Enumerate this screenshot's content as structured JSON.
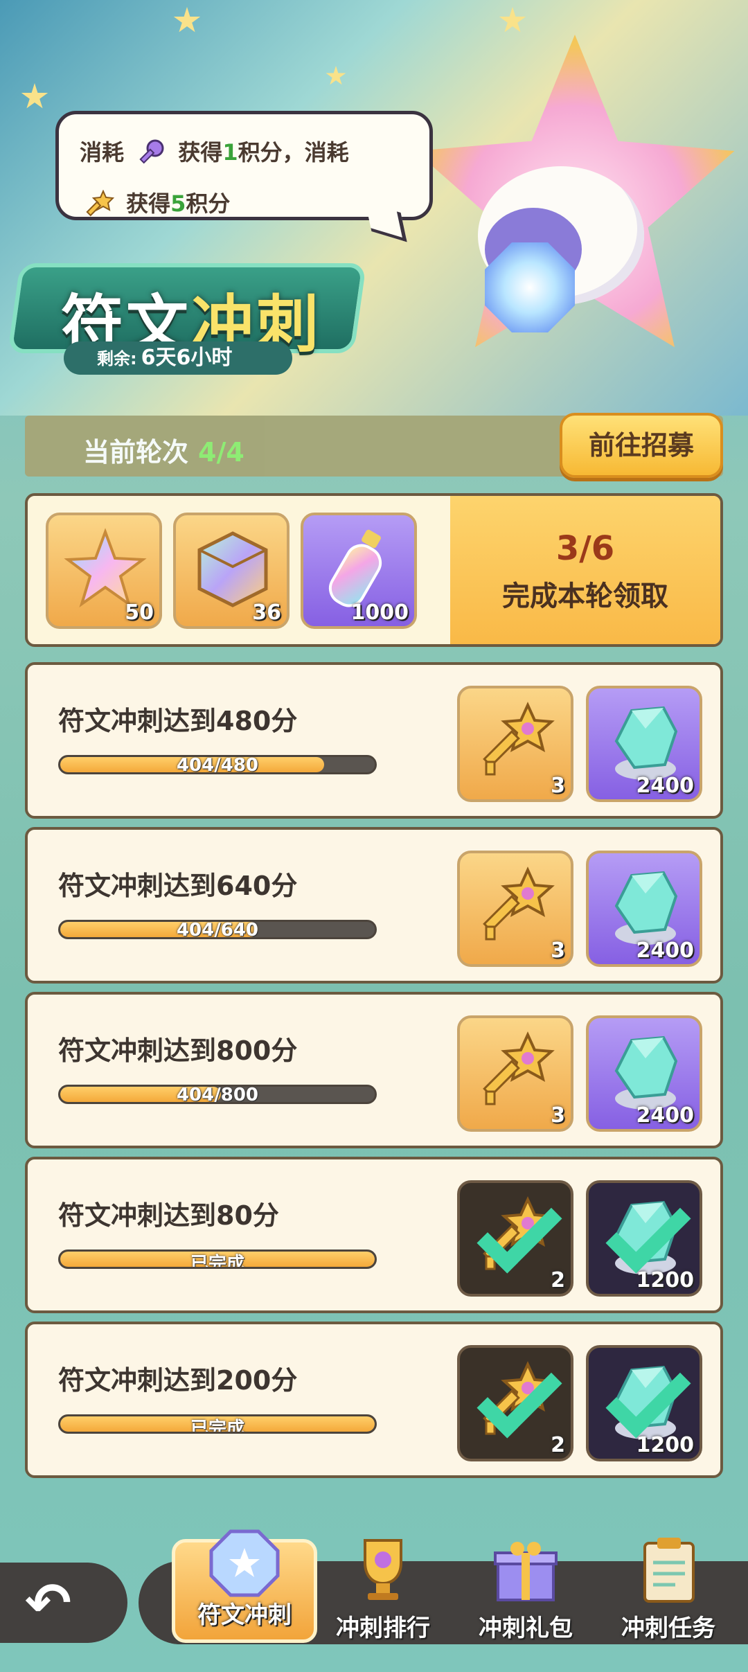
{
  "event": {
    "title_part1": "符文",
    "title_part2": "冲刺",
    "remain_label": "剩余:",
    "remain_value": "6天6小时"
  },
  "tip": {
    "line1_a": "消耗",
    "line1_b": "获得",
    "line1_num": "1",
    "line1_c": "积分，消耗",
    "line2_a": "获得",
    "line2_num": "5",
    "line2_b": "积分"
  },
  "round": {
    "label": "当前轮次",
    "value": "4/4",
    "goto_label": "前往招募"
  },
  "round_reward": {
    "items": [
      {
        "icon": "rainbow-star-icon",
        "count": "50"
      },
      {
        "icon": "rainbow-cube-icon",
        "count": "36"
      },
      {
        "icon": "rainbow-bottle-icon",
        "count": "1000"
      }
    ],
    "progress": "3/6",
    "claim_label": "完成本轮领取"
  },
  "tasks": [
    {
      "name": "符文冲刺达到480分",
      "progress_text": "404/480",
      "progress": 0.84,
      "rewards": [
        {
          "icon": "star-key-icon",
          "count": "3"
        },
        {
          "icon": "crystal-icon",
          "count": "2400"
        }
      ],
      "done": false
    },
    {
      "name": "符文冲刺达到640分",
      "progress_text": "404/640",
      "progress": 0.63,
      "rewards": [
        {
          "icon": "star-key-icon",
          "count": "3"
        },
        {
          "icon": "crystal-icon",
          "count": "2400"
        }
      ],
      "done": false
    },
    {
      "name": "符文冲刺达到800分",
      "progress_text": "404/800",
      "progress": 0.505,
      "rewards": [
        {
          "icon": "star-key-icon",
          "count": "3"
        },
        {
          "icon": "crystal-icon",
          "count": "2400"
        }
      ],
      "done": false
    },
    {
      "name": "符文冲刺达到80分",
      "progress_text": "已完成",
      "progress": 1,
      "rewards": [
        {
          "icon": "star-key-icon",
          "count": "2"
        },
        {
          "icon": "crystal-icon",
          "count": "1200"
        }
      ],
      "done": true
    },
    {
      "name": "符文冲刺达到200分",
      "progress_text": "已完成",
      "progress": 1,
      "rewards": [
        {
          "icon": "star-key-icon",
          "count": "2"
        },
        {
          "icon": "crystal-icon",
          "count": "1200"
        }
      ],
      "done": true
    }
  ],
  "nav": {
    "tabs": [
      {
        "label": "符文冲刺",
        "icon": "rune-gem-icon",
        "active": true
      },
      {
        "label": "冲刺排行",
        "icon": "trophy-icon",
        "active": false
      },
      {
        "label": "冲刺礼包",
        "icon": "gift-box-icon",
        "active": false
      },
      {
        "label": "冲刺任务",
        "icon": "clipboard-icon",
        "active": false
      }
    ]
  }
}
